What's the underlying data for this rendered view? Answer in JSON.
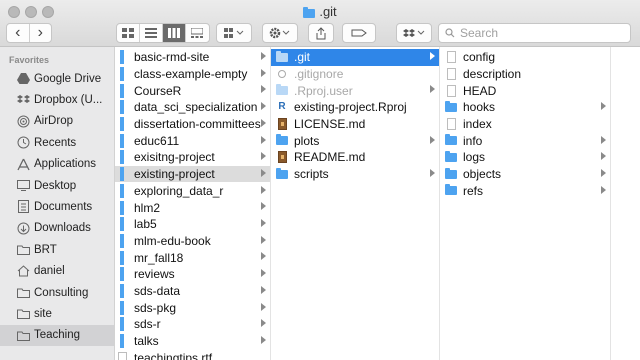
{
  "window": {
    "title": ".git"
  },
  "toolbar": {
    "back": "‹",
    "forward": "›",
    "search_placeholder": "Search"
  },
  "sidebar": {
    "heading": "Favorites",
    "items": [
      {
        "label": "Google Drive",
        "icon": "google-drive-icon"
      },
      {
        "label": "Dropbox (U...",
        "icon": "dropbox-icon"
      },
      {
        "label": "AirDrop",
        "icon": "airdrop-icon"
      },
      {
        "label": "Recents",
        "icon": "recents-icon"
      },
      {
        "label": "Applications",
        "icon": "applications-icon"
      },
      {
        "label": "Desktop",
        "icon": "desktop-icon"
      },
      {
        "label": "Documents",
        "icon": "documents-icon"
      },
      {
        "label": "Downloads",
        "icon": "downloads-icon"
      },
      {
        "label": "BRT",
        "icon": "folder-icon"
      },
      {
        "label": "daniel",
        "icon": "home-icon"
      },
      {
        "label": "Consulting",
        "icon": "folder-icon"
      },
      {
        "label": "site",
        "icon": "folder-icon"
      },
      {
        "label": "Teaching",
        "icon": "folder-icon",
        "selected": true
      }
    ]
  },
  "column1": [
    {
      "name": "basic-rmd-site",
      "folder": true
    },
    {
      "name": "class-example-empty",
      "folder": true
    },
    {
      "name": "CourseR",
      "folder": true
    },
    {
      "name": "data_sci_specialization",
      "folder": true
    },
    {
      "name": "dissertation-committees",
      "folder": true
    },
    {
      "name": "educ611",
      "folder": true
    },
    {
      "name": "exisitng-project",
      "folder": true
    },
    {
      "name": "existing-project",
      "folder": true,
      "selected": true
    },
    {
      "name": "exploring_data_r",
      "folder": true
    },
    {
      "name": "hlm2",
      "folder": true
    },
    {
      "name": "lab5",
      "folder": true
    },
    {
      "name": "mlm-edu-book",
      "folder": true
    },
    {
      "name": "mr_fall18",
      "folder": true
    },
    {
      "name": "reviews",
      "folder": true
    },
    {
      "name": "sds-data",
      "folder": true
    },
    {
      "name": "sds-pkg",
      "folder": true
    },
    {
      "name": "sds-r",
      "folder": true
    },
    {
      "name": "talks",
      "folder": true
    },
    {
      "name": "teachingtips.rtf",
      "folder": false
    }
  ],
  "column2": [
    {
      "name": ".git",
      "kind": "folder-faded",
      "selected": true,
      "chevron": true
    },
    {
      "name": ".gitignore",
      "kind": "gitignore",
      "hidden": true
    },
    {
      "name": ".Rproj.user",
      "kind": "folder-faded",
      "hidden": true,
      "chevron": true
    },
    {
      "name": "existing-project.Rproj",
      "kind": "rproj"
    },
    {
      "name": "LICENSE.md",
      "kind": "md"
    },
    {
      "name": "plots",
      "kind": "folder",
      "chevron": true
    },
    {
      "name": "README.md",
      "kind": "md"
    },
    {
      "name": "scripts",
      "kind": "folder",
      "chevron": true
    }
  ],
  "column3": [
    {
      "name": "config",
      "kind": "doc"
    },
    {
      "name": "description",
      "kind": "doc"
    },
    {
      "name": "HEAD",
      "kind": "doc"
    },
    {
      "name": "hooks",
      "kind": "folder",
      "chevron": true
    },
    {
      "name": "index",
      "kind": "doc"
    },
    {
      "name": "info",
      "kind": "folder",
      "chevron": true
    },
    {
      "name": "logs",
      "kind": "folder",
      "chevron": true
    },
    {
      "name": "objects",
      "kind": "folder",
      "chevron": true
    },
    {
      "name": "refs",
      "kind": "folder",
      "chevron": true
    }
  ],
  "colors": {
    "selection_blue": "#2f86e8",
    "folder_blue": "#4da3f0"
  }
}
